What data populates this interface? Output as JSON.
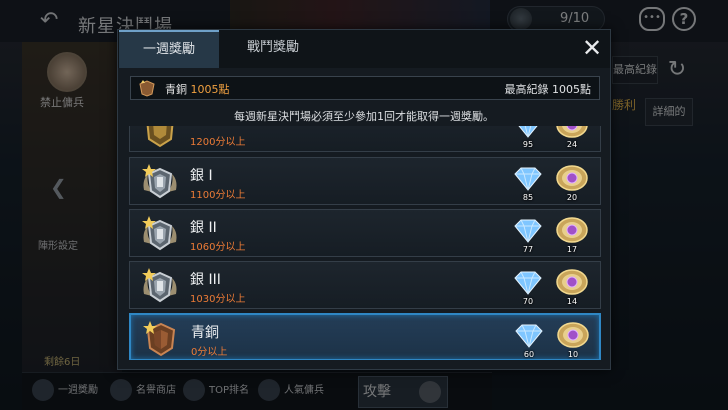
{
  "background": {
    "title": "新星決鬥場",
    "counter": "9/10",
    "ban_label": "禁止傭兵",
    "formation_label": "陣形設定",
    "days_left": "剩餘6日",
    "record_button": "最高紀錄",
    "win_label": "勝利",
    "detail_button": "詳細的",
    "bottom_tabs": [
      "一週獎勵",
      "名譽商店",
      "TOP排名",
      "人氣傭兵"
    ],
    "attack_button": "攻擊"
  },
  "modal": {
    "tabs": [
      "一週獎勵",
      "戰鬥獎勵"
    ],
    "active_tab": 0,
    "current_rank_name": "青銅",
    "current_points": "1005點",
    "best_record": "最高紀錄 1005點",
    "notice": "每週新星決鬥場必須至少參加1回才能取得一週獎勵。",
    "rows": [
      {
        "name": "",
        "req": "1200分以上",
        "gem": "95",
        "coin": "24",
        "tier": "gold",
        "selected": false
      },
      {
        "name": "銀 I",
        "req": "1100分以上",
        "gem": "85",
        "coin": "20",
        "tier": "silver",
        "selected": false
      },
      {
        "name": "銀 II",
        "req": "1060分以上",
        "gem": "77",
        "coin": "17",
        "tier": "silver",
        "selected": false
      },
      {
        "name": "銀 III",
        "req": "1030分以上",
        "gem": "70",
        "coin": "14",
        "tier": "silver",
        "selected": false
      },
      {
        "name": "青銅",
        "req": "0分以上",
        "gem": "60",
        "coin": "10",
        "tier": "bronze",
        "selected": true
      }
    ]
  },
  "colors": {
    "accent": "#2f87c4",
    "requirement": "#ec7b36",
    "points": "#f0a040"
  },
  "icons": {
    "close": "close-icon",
    "gem": "diamond-icon",
    "coin": "honor-coin-icon",
    "medal": "rank-medal-icon"
  }
}
